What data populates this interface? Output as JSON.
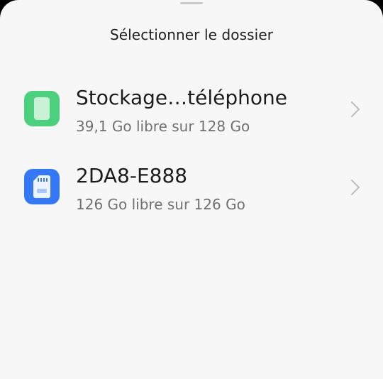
{
  "sheet": {
    "title": "Sélectionner le dossier"
  },
  "storage": [
    {
      "name": "Stockage…téléphone",
      "detail": "39,1 Go libre sur 128 Go",
      "icon": "phone-storage-icon",
      "icon_color": "#4cd07d"
    },
    {
      "name": "2DA8-E888",
      "detail": "126 Go libre sur 126 Go",
      "icon": "sd-card-icon",
      "icon_color": "#3478f6"
    }
  ]
}
